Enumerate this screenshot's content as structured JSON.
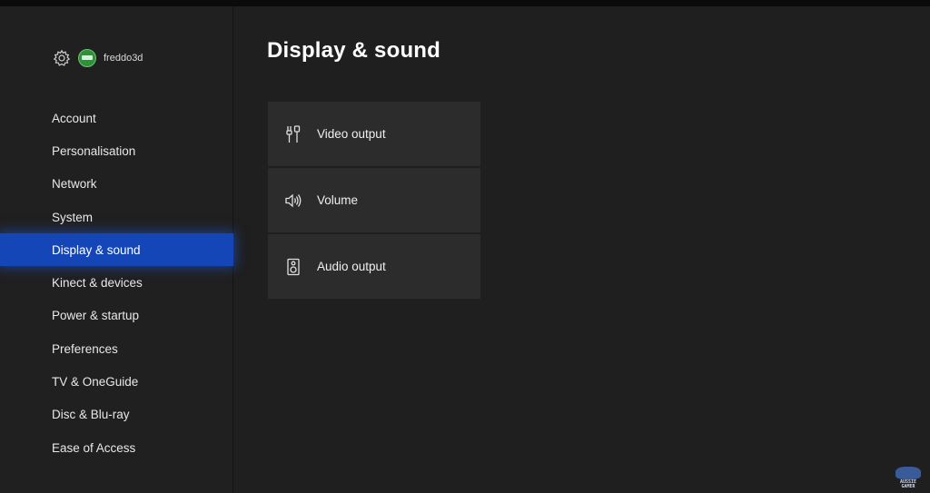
{
  "profile": {
    "gamertag": "freddo3d",
    "icons": [
      "gear-icon",
      "avatar"
    ]
  },
  "sidebar": {
    "items": [
      {
        "label": "Account"
      },
      {
        "label": "Personalisation"
      },
      {
        "label": "Network"
      },
      {
        "label": "System"
      },
      {
        "label": "Display & sound",
        "selected": true
      },
      {
        "label": "Kinect & devices"
      },
      {
        "label": "Power & startup"
      },
      {
        "label": "Preferences"
      },
      {
        "label": "TV & OneGuide"
      },
      {
        "label": "Disc & Blu-ray"
      },
      {
        "label": "Ease of Access"
      }
    ]
  },
  "main": {
    "title": "Display & sound",
    "tiles": [
      {
        "label": "Video output",
        "icon": "video-output-icon"
      },
      {
        "label": "Volume",
        "icon": "volume-icon"
      },
      {
        "label": "Audio output",
        "icon": "speaker-icon"
      }
    ]
  },
  "watermark": {
    "line1": "AUSSIE",
    "line2": "GAMER"
  },
  "colors": {
    "accent": "#1446b8",
    "background": "#1f1f1f",
    "tile": "#2c2c2c",
    "text": "#ffffff"
  }
}
